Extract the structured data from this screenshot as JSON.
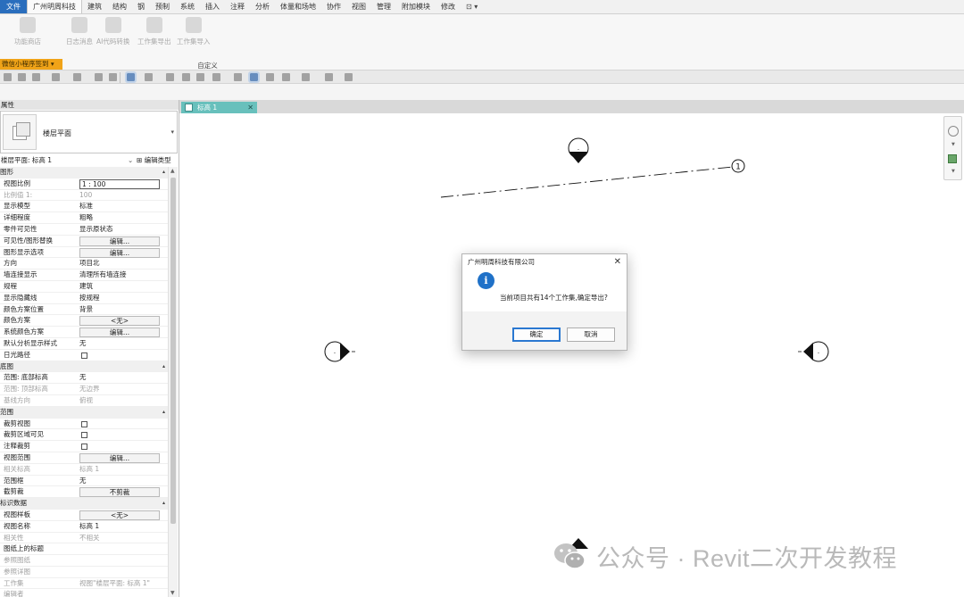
{
  "ribbon": {
    "tabs": [
      "文件",
      "广州明周科技",
      "建筑",
      "结构",
      "钢",
      "预制",
      "系统",
      "插入",
      "注释",
      "分析",
      "体量和场地",
      "协作",
      "视图",
      "管理",
      "附加模块",
      "修改",
      "⊡ ▾"
    ],
    "buttons": [
      "功能商店",
      "日志消息",
      "AI代码转换",
      "工作集导出",
      "工作集导入"
    ],
    "panel_title": "自定义",
    "orange_tab": "微信小程序签到 ▾"
  },
  "properties": {
    "header": "属性",
    "type_name": "楼层平面",
    "filter": "楼层平面: 标高 1",
    "edit_type": "⊞ 编辑类型",
    "rows": [
      {
        "kind": "section",
        "k": "图形"
      },
      {
        "kind": "input",
        "k": "视图比例",
        "v": "1 : 100"
      },
      {
        "kind": "muted",
        "k": "比例值 1:",
        "v": "100"
      },
      {
        "kind": "text",
        "k": "显示模型",
        "v": "标准"
      },
      {
        "kind": "text",
        "k": "详细程度",
        "v": "粗略"
      },
      {
        "kind": "text",
        "k": "零件可见性",
        "v": "显示原状态"
      },
      {
        "kind": "button",
        "k": "可见性/图形替换",
        "v": "编辑..."
      },
      {
        "kind": "button",
        "k": "图形显示选项",
        "v": "编辑..."
      },
      {
        "kind": "text",
        "k": "方向",
        "v": "项目北"
      },
      {
        "kind": "text",
        "k": "墙连接显示",
        "v": "清理所有墙连接"
      },
      {
        "kind": "text",
        "k": "规程",
        "v": "建筑"
      },
      {
        "kind": "text",
        "k": "显示隐藏线",
        "v": "按规程"
      },
      {
        "kind": "text",
        "k": "颜色方案位置",
        "v": "背景"
      },
      {
        "kind": "button",
        "k": "颜色方案",
        "v": "<无>"
      },
      {
        "kind": "button",
        "k": "系统颜色方案",
        "v": "编辑..."
      },
      {
        "kind": "text",
        "k": "默认分析显示样式",
        "v": "无"
      },
      {
        "kind": "check",
        "k": "日光路径"
      },
      {
        "kind": "section",
        "k": "底图"
      },
      {
        "kind": "text",
        "k": "范围: 底部标高",
        "v": "无"
      },
      {
        "kind": "muted",
        "k": "范围: 顶部标高",
        "v": "无边界"
      },
      {
        "kind": "muted",
        "k": "基线方向",
        "v": "俯视"
      },
      {
        "kind": "section",
        "k": "范围"
      },
      {
        "kind": "check",
        "k": "裁剪视图"
      },
      {
        "kind": "check",
        "k": "裁剪区域可见"
      },
      {
        "kind": "check",
        "k": "注释裁剪"
      },
      {
        "kind": "button",
        "k": "视图范围",
        "v": "编辑..."
      },
      {
        "kind": "muted",
        "k": "相关标高",
        "v": "标高 1"
      },
      {
        "kind": "text",
        "k": "范围框",
        "v": "无"
      },
      {
        "kind": "button",
        "k": "截剪裁",
        "v": "不剪裁"
      },
      {
        "kind": "section",
        "k": "标识数据"
      },
      {
        "kind": "button",
        "k": "视图样板",
        "v": "<无>"
      },
      {
        "kind": "text",
        "k": "视图名称",
        "v": "标高 1"
      },
      {
        "kind": "muted",
        "k": "相关性",
        "v": "不相关"
      },
      {
        "kind": "text",
        "k": "图纸上的标题",
        "v": ""
      },
      {
        "kind": "muted",
        "k": "参照图纸",
        "v": ""
      },
      {
        "kind": "muted",
        "k": "参照详图",
        "v": ""
      },
      {
        "kind": "muted",
        "k": "工作集",
        "v": "视图\"楼层平面: 标高 1\""
      },
      {
        "kind": "muted",
        "k": "编辑者",
        "v": ""
      }
    ]
  },
  "view": {
    "tab_label": "标高 1",
    "level_bubble_label": "1",
    "elevation_marker_text": "-"
  },
  "dialog": {
    "title": "广州明周科技有限公司",
    "icon": "i",
    "message": "当前项目共有14个工作集,确定导出?",
    "ok": "确定",
    "cancel": "取消"
  },
  "watermark": {
    "text": "公众号 · Revit二次开发教程"
  },
  "colors": {
    "file_tab": "#2a6ebd",
    "view_tab": "#68c0bc",
    "orange_tab": "#f0a318",
    "info_icon": "#1f71c8"
  }
}
